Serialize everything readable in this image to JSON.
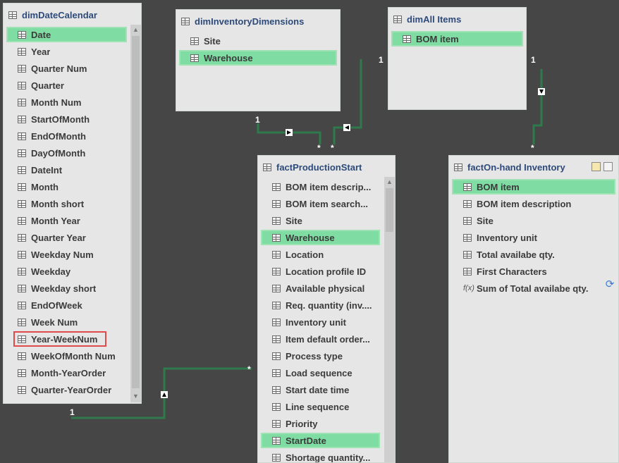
{
  "tables": {
    "dimDateCalendar": {
      "title": "dimDateCalendar",
      "fields": [
        "Date",
        "Year",
        "Quarter Num",
        "Quarter",
        "Month Num",
        "StartOfMonth",
        "EndOfMonth",
        "DayOfMonth",
        "DateInt",
        "Month",
        "Month short",
        "Month Year",
        "Quarter Year",
        "Weekday Num",
        "Weekday",
        "Weekday short",
        "EndOfWeek",
        "Week Num",
        "Year-WeekNum",
        "WeekOfMonth Num",
        "Month-YearOrder",
        "Quarter-YearOrder"
      ]
    },
    "dimInventoryDimensions": {
      "title": "dimInventoryDimensions",
      "fields": [
        "Site",
        "Warehouse"
      ]
    },
    "dimAllItems": {
      "title": "dimAll Items",
      "fields": [
        "BOM item"
      ]
    },
    "factProductionStart": {
      "title": "factProductionStart",
      "fields": [
        "BOM item descrip...",
        "BOM item search...",
        "Site",
        "Warehouse",
        "Location",
        "Location profile ID",
        "Available physical",
        "Req. quantity (inv....",
        "Inventory unit",
        "Item default order...",
        "Process type",
        "Load sequence",
        "Start date time",
        "Line sequence",
        "Priority",
        "StartDate",
        "Shortage quantity..."
      ]
    },
    "factOnhandInventory": {
      "title": "factOn-hand Inventory",
      "fields": [
        "BOM item",
        "BOM item description",
        "Site",
        "Inventory unit",
        "Total availabe qty.",
        "First Characters"
      ],
      "measure": "Sum of Total availabe qty."
    }
  },
  "relationships": [
    {
      "from": "dimInventoryDimensions",
      "to": "factProductionStart",
      "one_label": "1",
      "many_label": "*"
    },
    {
      "from": "dimAllItems",
      "to": "factProductionStart",
      "one_label": "1",
      "many_label": "*"
    },
    {
      "from": "dimAllItems",
      "to": "factOnhandInventory",
      "one_label": "1",
      "many_label": "*"
    },
    {
      "from": "dimDateCalendar",
      "to": "factProductionStart",
      "one_label": "1",
      "many_label": "*"
    }
  ],
  "icons": {
    "table": "table-icon",
    "column": "column-icon",
    "measure": "fx-measure-icon",
    "refresh": "refresh-icon"
  },
  "colors": {
    "canvas": "#464646",
    "table_bg": "#e6e6e6",
    "selection": "#7fdca2",
    "highlight_border": "#e04a4a",
    "relationship_line": "#2f7a4c",
    "title_text": "#2d4a7a"
  }
}
